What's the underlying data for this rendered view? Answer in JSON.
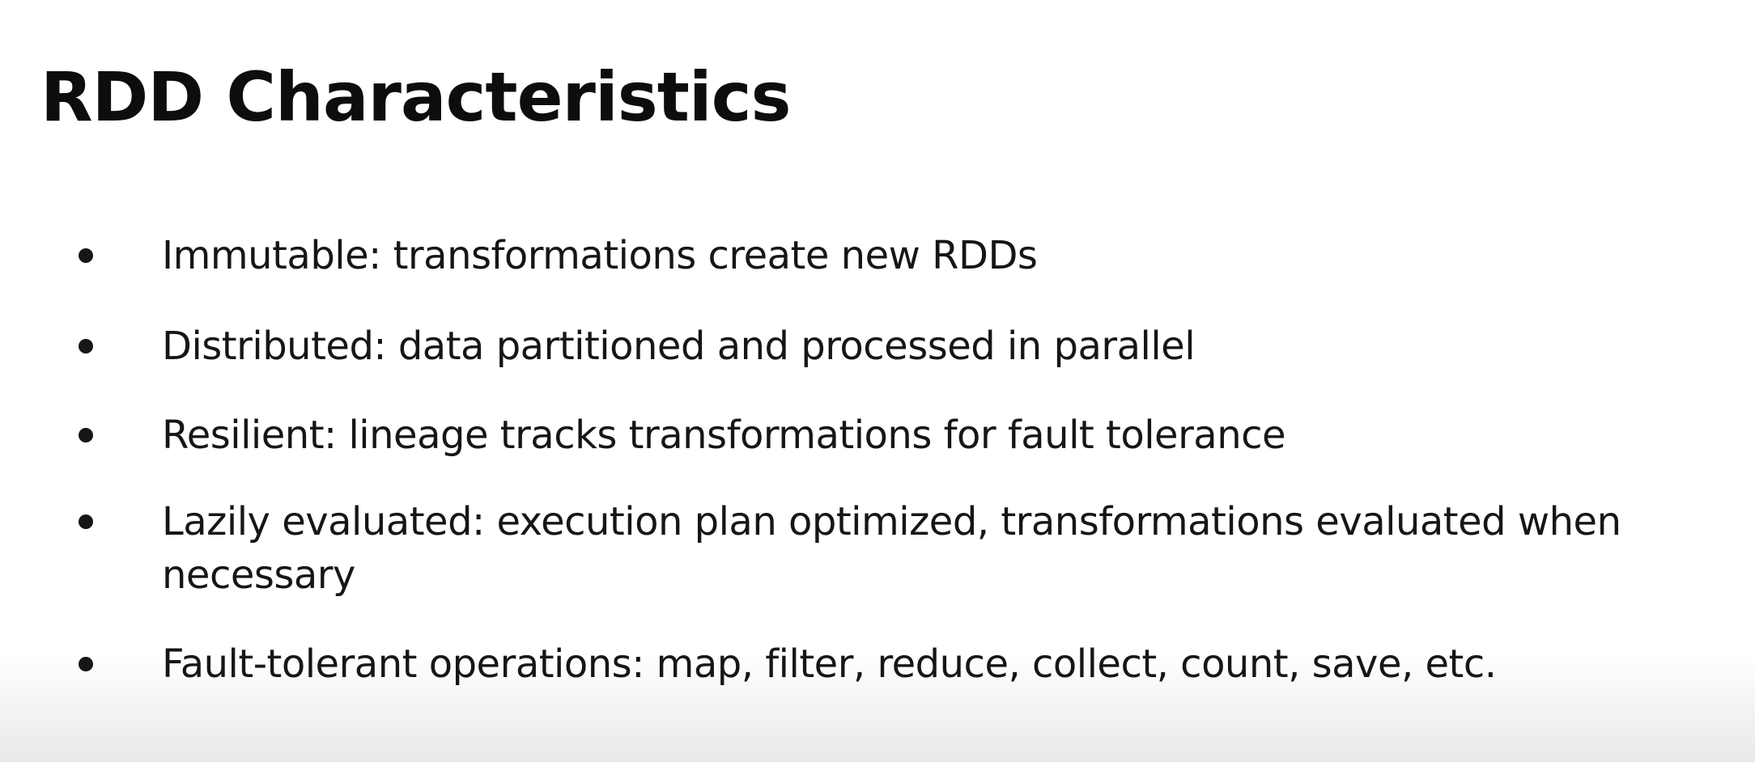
{
  "slide": {
    "title": "RDD Characteristics",
    "bullets": [
      "Immutable: transformations create new RDDs",
      "Distributed: data partitioned and processed in parallel",
      "Resilient: lineage tracks transformations for fault tolerance",
      "Lazily evaluated: execution plan optimized, transformations evaluated when necessary",
      "Fault-tolerant operations: map, filter, reduce, collect, count, save, etc."
    ]
  }
}
